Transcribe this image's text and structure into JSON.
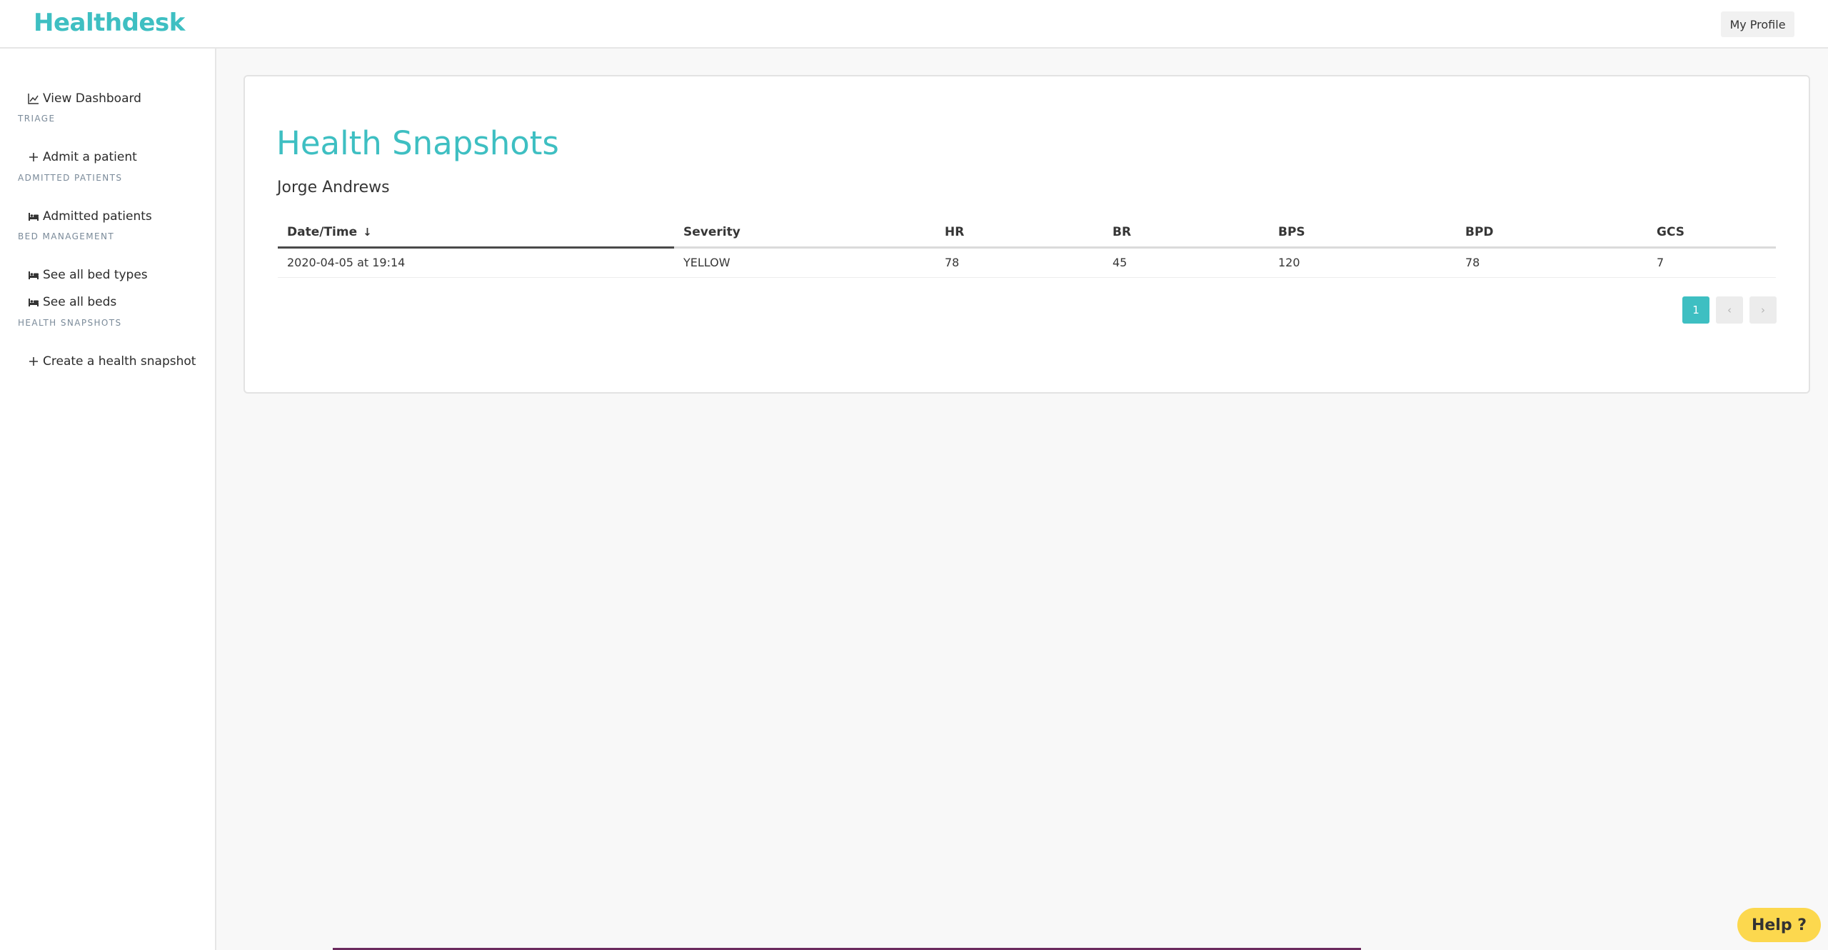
{
  "app": {
    "brand": "Healthdesk",
    "profile_label": "My Profile"
  },
  "sidebar": {
    "dashboard": {
      "label": "View Dashboard",
      "icon": "chart-line-icon"
    },
    "sections": [
      {
        "title": "TRIAGE",
        "items": [
          {
            "label": "Admit a patient",
            "icon": "plus-icon"
          }
        ]
      },
      {
        "title": "ADMITTED PATIENTS",
        "items": [
          {
            "label": "Admitted patients",
            "icon": "bed-icon"
          }
        ]
      },
      {
        "title": "BED MANAGEMENT",
        "items": [
          {
            "label": "See all bed types",
            "icon": "bed-icon"
          },
          {
            "label": "See all beds",
            "icon": "bed-icon"
          }
        ]
      },
      {
        "title": "HEALTH SNAPSHOTS",
        "items": [
          {
            "label": "Create a health snapshot",
            "icon": "plus-icon"
          }
        ]
      }
    ]
  },
  "main": {
    "title": "Health Snapshots",
    "patient_name": "Jorge Andrews",
    "table": {
      "columns": [
        "Date/Time",
        "Severity",
        "HR",
        "BR",
        "BPS",
        "BPD",
        "GCS"
      ],
      "sort_indicator": "↓",
      "rows": [
        [
          "2020-04-05 at 19:14",
          "YELLOW",
          "78",
          "45",
          "120",
          "78",
          "7"
        ]
      ]
    },
    "pagination": {
      "current": "1",
      "prev": "‹",
      "next": "›"
    }
  },
  "help": {
    "label": "Help ?"
  },
  "colors": {
    "accent": "#3ebfc2",
    "help": "#fcd84e"
  }
}
